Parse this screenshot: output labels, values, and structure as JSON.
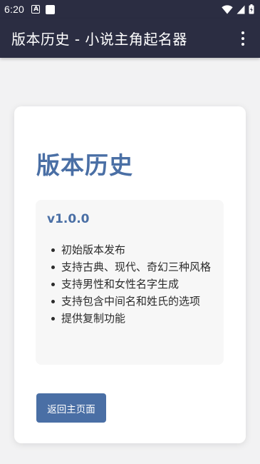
{
  "status_bar": {
    "time": "6:20",
    "icons": [
      "a-notification-icon",
      "app-notification-icon",
      "wifi-icon",
      "cellular-signal-icon",
      "battery-icon"
    ]
  },
  "app_bar": {
    "title": "版本历史 - 小说主角起名器",
    "menu_icon": "more-vert-icon"
  },
  "content": {
    "page_title": "版本历史",
    "versions": [
      {
        "version": "v1.0.0",
        "changes": [
          "初始版本发布",
          "支持古典、现代、奇幻三种风格",
          "支持男性和女性名字生成",
          "支持包含中间名和姓氏的选项",
          "提供复制功能"
        ]
      }
    ],
    "back_button_label": "返回主页面"
  },
  "colors": {
    "app_bar_bg": "#2b2d42",
    "accent": "#4a6fa5",
    "page_bg": "#f2f2f3",
    "card_bg": "#ffffff",
    "version_box_bg": "#f7f7f7"
  }
}
